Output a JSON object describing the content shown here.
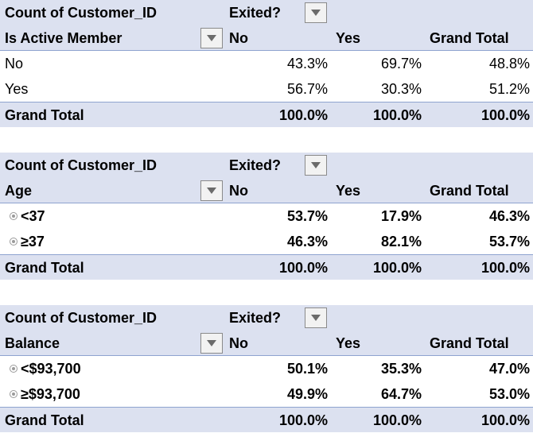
{
  "tables": [
    {
      "measure_label": "Count of Customer_ID",
      "column_field": "Exited?",
      "row_field": "Is Active Member",
      "col_headers": [
        "No",
        "Yes",
        "Grand Total"
      ],
      "expandable": false,
      "bold_rows": false,
      "rows": [
        {
          "label": "No",
          "values": [
            "43.3%",
            "69.7%",
            "48.8%"
          ]
        },
        {
          "label": "Yes",
          "values": [
            "56.7%",
            "30.3%",
            "51.2%"
          ]
        }
      ],
      "grand_total": {
        "label": "Grand Total",
        "values": [
          "100.0%",
          "100.0%",
          "100.0%"
        ]
      }
    },
    {
      "measure_label": "Count of Customer_ID",
      "column_field": "Exited?",
      "row_field": "Age",
      "col_headers": [
        "No",
        "Yes",
        "Grand Total"
      ],
      "expandable": true,
      "bold_rows": true,
      "rows": [
        {
          "label": "<37",
          "values": [
            "53.7%",
            "17.9%",
            "46.3%"
          ]
        },
        {
          "label": "≥37",
          "values": [
            "46.3%",
            "82.1%",
            "53.7%"
          ]
        }
      ],
      "grand_total": {
        "label": "Grand Total",
        "values": [
          "100.0%",
          "100.0%",
          "100.0%"
        ]
      }
    },
    {
      "measure_label": "Count of Customer_ID",
      "column_field": "Exited?",
      "row_field": "Balance",
      "col_headers": [
        "No",
        "Yes",
        "Grand Total"
      ],
      "expandable": true,
      "bold_rows": true,
      "rows": [
        {
          "label": "<$93,700",
          "values": [
            "50.1%",
            "35.3%",
            "47.0%"
          ]
        },
        {
          "label": "≥$93,700",
          "values": [
            "49.9%",
            "64.7%",
            "53.0%"
          ]
        }
      ],
      "grand_total": {
        "label": "Grand Total",
        "values": [
          "100.0%",
          "100.0%",
          "100.0%"
        ]
      }
    }
  ],
  "icons": {
    "dropdown": "filter-dropdown-icon",
    "expander": "expand-collapse-icon"
  },
  "colors": {
    "header_bg": "#dce1f0",
    "rule": "#8ea3cf",
    "button_border": "#8a8a8a"
  }
}
